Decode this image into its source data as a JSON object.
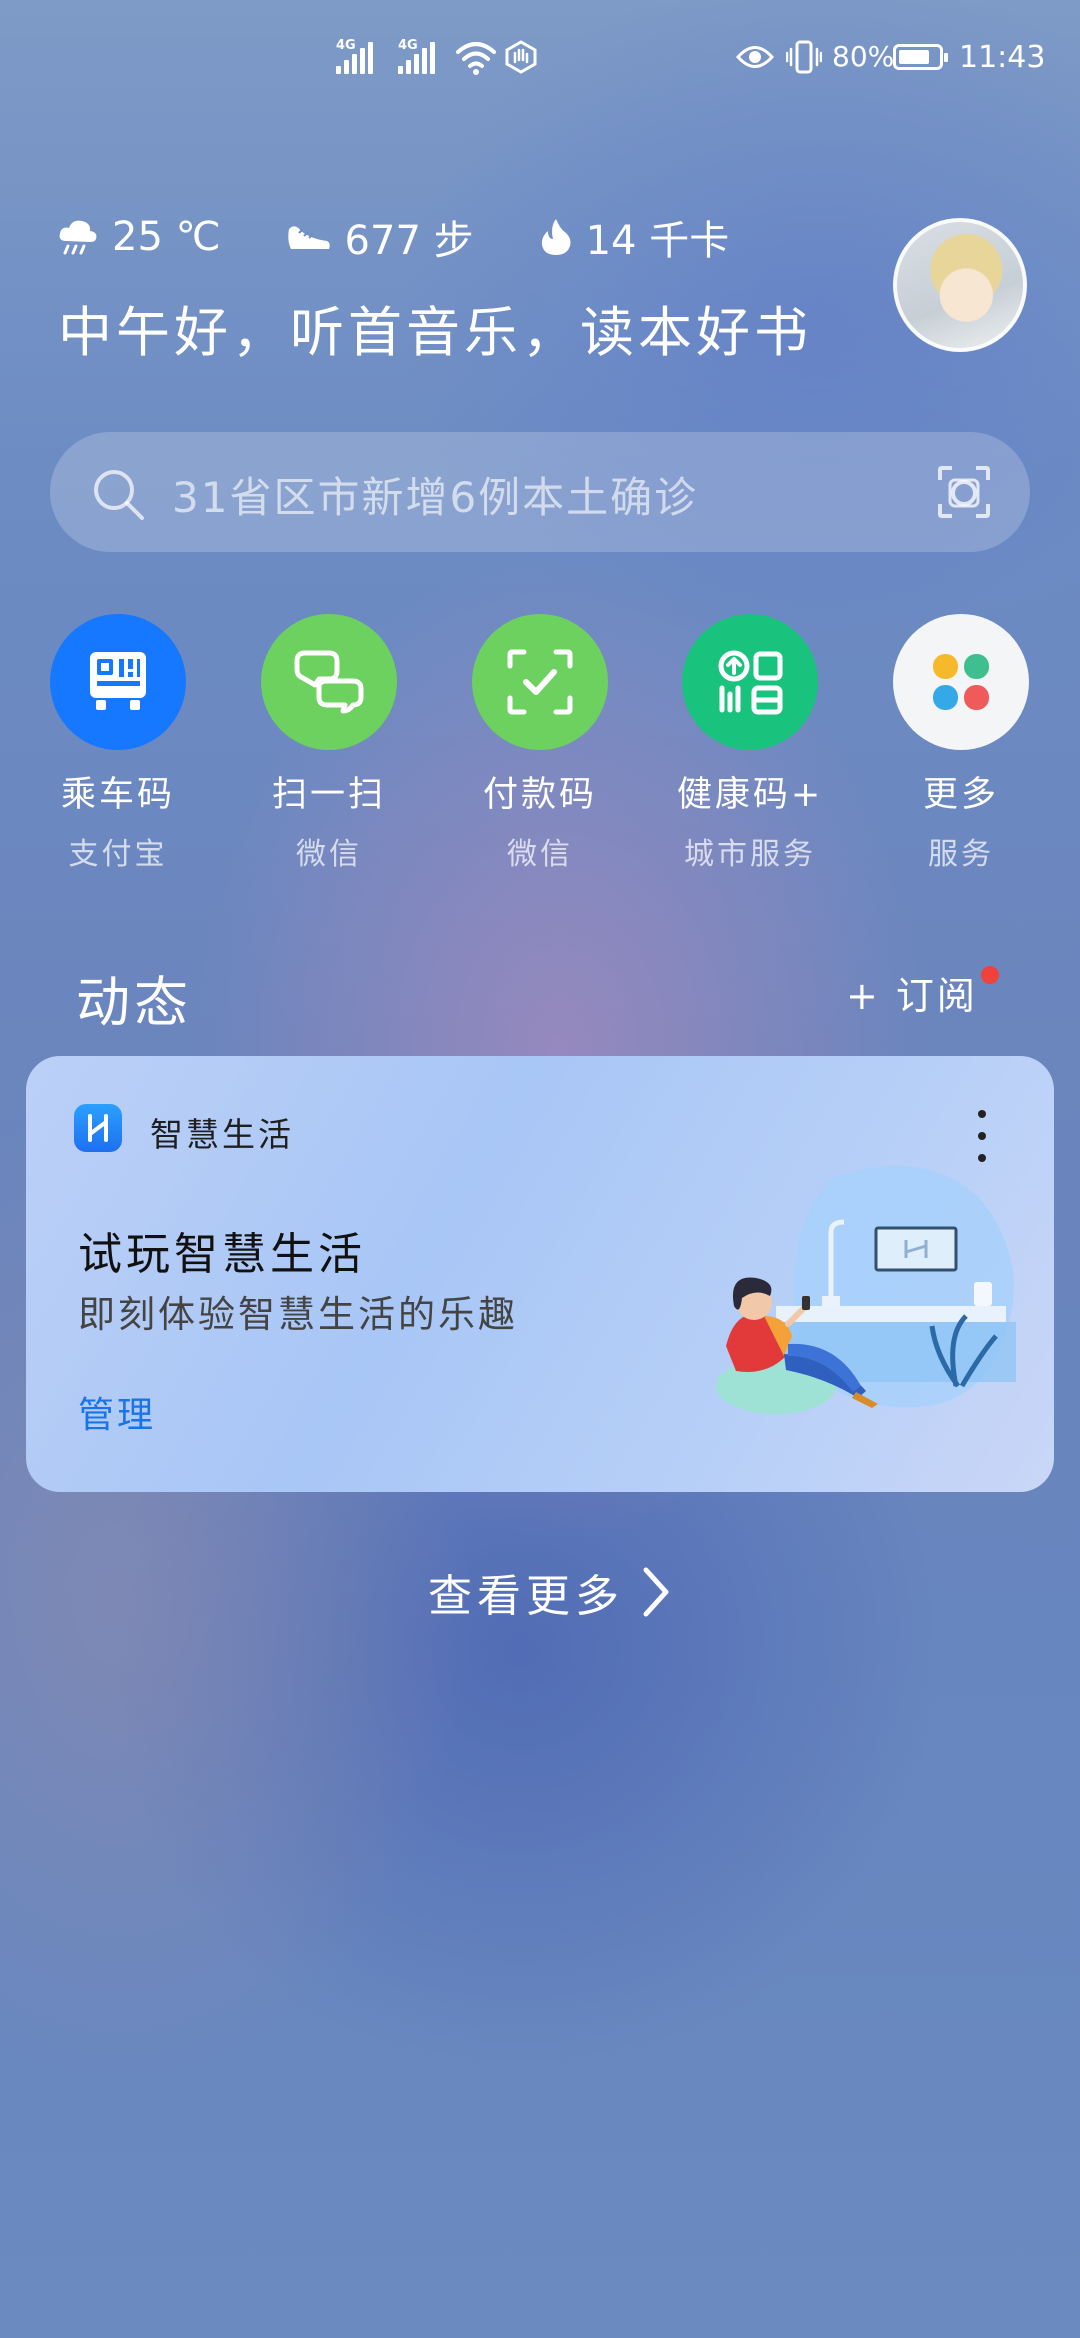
{
  "status_bar": {
    "signal1_label": "4G",
    "signal2_label": "4G",
    "battery_percent": "80%",
    "time": "11:43",
    "battery_level": 0.8
  },
  "info": {
    "weather": "25 ℃",
    "steps": "677 步",
    "calories": "14 千卡"
  },
  "greeting": "中午好，听首音乐，读本好书",
  "search": {
    "placeholder": "31省区市新增6例本土确诊"
  },
  "quick_apps": [
    {
      "label": "乘车码",
      "sub": "支付宝",
      "color": "#1677ff",
      "icon": "bus-code-icon"
    },
    {
      "label": "扫一扫",
      "sub": "微信",
      "color": "#6cd15f",
      "icon": "scan-icon"
    },
    {
      "label": "付款码",
      "sub": "微信",
      "color": "#6cd15f",
      "icon": "payment-code-icon"
    },
    {
      "label": "健康码+",
      "sub": "城市服务",
      "color": "#19c37d",
      "icon": "health-code-icon"
    },
    {
      "label": "更多",
      "sub": "服务",
      "color": "#f4f5f7",
      "icon": "more-apps-icon"
    }
  ],
  "feed": {
    "title": "动态",
    "subscribe_label": "+ 订阅"
  },
  "card": {
    "app_name": "智慧生活",
    "title": "试玩智慧生活",
    "description": "即刻体验智慧生活的乐趣",
    "manage_label": "管理"
  },
  "see_more_label": "查看更多"
}
